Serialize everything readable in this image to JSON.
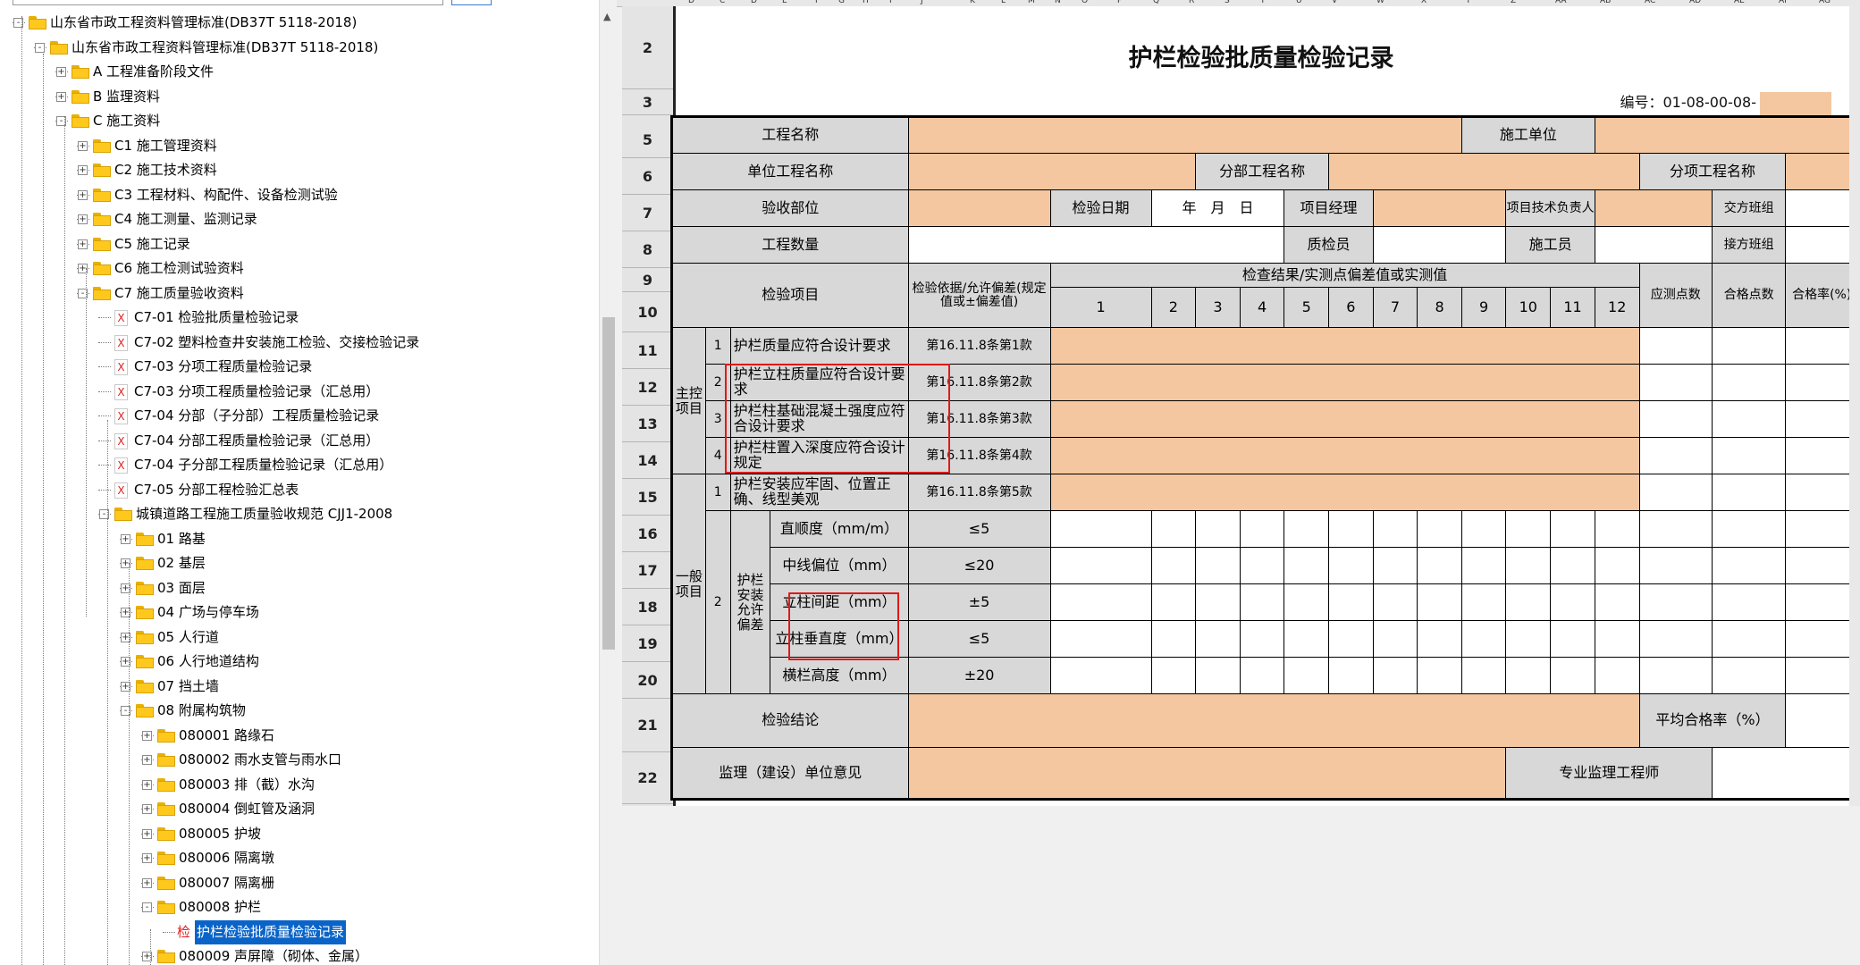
{
  "tree": {
    "items": [
      {
        "label": "山东省市政工程资料管理标准(DB37T 5118-2018)",
        "level": 0,
        "type": "folder",
        "expand": "-"
      },
      {
        "label": "山东省市政工程资料管理标准(DB37T 5118-2018)",
        "level": 1,
        "type": "folder",
        "expand": "-"
      },
      {
        "label": "A 工程准备阶段文件",
        "level": 2,
        "type": "folder",
        "expand": "+"
      },
      {
        "label": "B 监理资料",
        "level": 2,
        "type": "folder",
        "expand": "+"
      },
      {
        "label": "C 施工资料",
        "level": 2,
        "type": "folder",
        "expand": "-"
      },
      {
        "label": "C1 施工管理资料",
        "level": 3,
        "type": "folder",
        "expand": "+"
      },
      {
        "label": "C2 施工技术资料",
        "level": 3,
        "type": "folder",
        "expand": "+"
      },
      {
        "label": "C3 工程材料、构配件、设备检测试验",
        "level": 3,
        "type": "folder",
        "expand": "+"
      },
      {
        "label": "C4 施工测量、监测记录",
        "level": 3,
        "type": "folder",
        "expand": "+"
      },
      {
        "label": "C5 施工记录",
        "level": 3,
        "type": "folder",
        "expand": "+"
      },
      {
        "label": "C6 施工检测试验资料",
        "level": 3,
        "type": "folder",
        "expand": "+"
      },
      {
        "label": "C7 施工质量验收资料",
        "level": 3,
        "type": "folder",
        "expand": "-"
      },
      {
        "label": "C7-01 检验批质量检验记录",
        "level": 4,
        "type": "doc"
      },
      {
        "label": "C7-02 塑料检查井安装施工检验、交接检验记录",
        "level": 4,
        "type": "doc"
      },
      {
        "label": "C7-03 分项工程质量检验记录",
        "level": 4,
        "type": "doc"
      },
      {
        "label": "C7-03 分项工程质量检验记录（汇总用）",
        "level": 4,
        "type": "doc"
      },
      {
        "label": "C7-04 分部（子分部）工程质量检验记录",
        "level": 4,
        "type": "doc"
      },
      {
        "label": "C7-04 分部工程质量检验记录（汇总用）",
        "level": 4,
        "type": "doc"
      },
      {
        "label": "C7-04 子分部工程质量检验记录（汇总用）",
        "level": 4,
        "type": "doc"
      },
      {
        "label": "C7-05 分部工程检验汇总表",
        "level": 4,
        "type": "doc"
      },
      {
        "label": "城镇道路工程施工质量验收规范 CJJ1-2008",
        "level": 4,
        "type": "folder",
        "expand": "-"
      },
      {
        "label": "01 路基",
        "level": 5,
        "type": "folder",
        "expand": "+"
      },
      {
        "label": "02 基层",
        "level": 5,
        "type": "folder",
        "expand": "+"
      },
      {
        "label": "03 面层",
        "level": 5,
        "type": "folder",
        "expand": "+"
      },
      {
        "label": "04 广场与停车场",
        "level": 5,
        "type": "folder",
        "expand": "+"
      },
      {
        "label": "05 人行道",
        "level": 5,
        "type": "folder",
        "expand": "+"
      },
      {
        "label": "06 人行地道结构",
        "level": 5,
        "type": "folder",
        "expand": "+"
      },
      {
        "label": "07 挡土墙",
        "level": 5,
        "type": "folder",
        "expand": "+"
      },
      {
        "label": "08 附属构筑物",
        "level": 5,
        "type": "folder",
        "expand": "-"
      },
      {
        "label": "080001 路缘石",
        "level": 6,
        "type": "folder",
        "expand": "+"
      },
      {
        "label": "080002 雨水支管与雨水口",
        "level": 6,
        "type": "folder",
        "expand": "+"
      },
      {
        "label": "080003 排（截）水沟",
        "level": 6,
        "type": "folder",
        "expand": "+"
      },
      {
        "label": "080004 倒虹管及涵洞",
        "level": 6,
        "type": "folder",
        "expand": "+"
      },
      {
        "label": "080005 护坡",
        "level": 6,
        "type": "folder",
        "expand": "+"
      },
      {
        "label": "080006 隔离墩",
        "level": 6,
        "type": "folder",
        "expand": "+"
      },
      {
        "label": "080007 隔离栅",
        "level": 6,
        "type": "folder",
        "expand": "+"
      },
      {
        "label": "080008 护栏",
        "level": 6,
        "type": "folder",
        "expand": "-"
      },
      {
        "label": "护栏检验批质量检验记录",
        "level": 7,
        "type": "jian",
        "prefix": "检",
        "selected": true
      },
      {
        "label": "080009 声屏障（砌体、金属）",
        "level": 6,
        "type": "folder",
        "expand": "+"
      }
    ]
  },
  "sheet": {
    "col_letters": [
      "D",
      "C",
      "D",
      "E",
      "F",
      "G",
      "H",
      "I",
      "J",
      "K",
      "L",
      "M",
      "N",
      "O",
      "P",
      "Q",
      "R",
      "S",
      "T",
      "U",
      "V",
      "W",
      "X",
      "Y",
      "Z",
      "AA",
      "AB",
      "AC",
      "AD",
      "AE",
      "AF",
      "AG"
    ],
    "row_numbers": [
      "2",
      "3",
      "5",
      "6",
      "7",
      "8",
      "9",
      "10",
      "11",
      "12",
      "13",
      "14",
      "15",
      "16",
      "17",
      "18",
      "19",
      "20",
      "21",
      "22"
    ],
    "title": "护栏检验批质量检验记录",
    "code_label": "编号：01-08-00-08-",
    "labels": {
      "project_name": "工程名称",
      "contractor": "施工单位",
      "unit_project": "单位工程名称",
      "division": "分部工程名称",
      "subitem": "分项工程名称",
      "accept_part": "验收部位",
      "inspect_date": "检验日期",
      "date_fmt": "年　月　日",
      "pm": "项目经理",
      "tech_lead": "项目技术负责人",
      "hand_over": "交方班组",
      "quantity": "工程数量",
      "qc": "质检员",
      "worker": "施工员",
      "take_over": "接方班组",
      "inspect_item": "检验项目",
      "basis": "检验依据/允许偏差(规定值或±偏差值)",
      "results": "检查结果/实测点偏差值或实测值",
      "should_count": "应测点数",
      "pass_count": "合格点数",
      "pass_rate": "合格率(%)",
      "main_ctrl": "主控项目",
      "general": "一般项目",
      "install_dev": "护栏安装允许偏差",
      "conclusion": "检验结论",
      "avg_rate": "平均合格率（%）",
      "supervision": "监理（建设）单位意见",
      "engineer": "专业监理工程师"
    },
    "result_cols": [
      "1",
      "2",
      "3",
      "4",
      "5",
      "6",
      "7",
      "8",
      "9",
      "10",
      "11",
      "12"
    ],
    "main_items": [
      {
        "no": "1",
        "text": "护栏质量应符合设计要求",
        "basis": "第16.11.8条第1款"
      },
      {
        "no": "2",
        "text": "护栏立柱质量应符合设计要求",
        "basis": "第16.11.8条第2款"
      },
      {
        "no": "3",
        "text": "护栏柱基础混凝土强度应符合设计要求",
        "basis": "第16.11.8条第3款"
      },
      {
        "no": "4",
        "text": "护栏柱置入深度应符合设计规定",
        "basis": "第16.11.8条第4款"
      }
    ],
    "general_item1": {
      "no": "1",
      "text": "护栏安装应牢固、位置正确、线型美观",
      "basis": "第16.11.8条第5款"
    },
    "general_no2": "2",
    "deviations": [
      {
        "text": "直顺度（mm/m）",
        "basis": "≤5"
      },
      {
        "text": "中线偏位（mm）",
        "basis": "≤20"
      },
      {
        "text": "立柱间距（mm）",
        "basis": "±5"
      },
      {
        "text": "立柱垂直度（mm）",
        "basis": "≤5"
      },
      {
        "text": "横栏高度（mm）",
        "basis": "±20"
      }
    ]
  },
  "colors": {
    "input_fill": "#f4c7a1",
    "label_fill": "#d8d8d8",
    "annotation": "#e01919",
    "selection": "#0a64c8"
  }
}
